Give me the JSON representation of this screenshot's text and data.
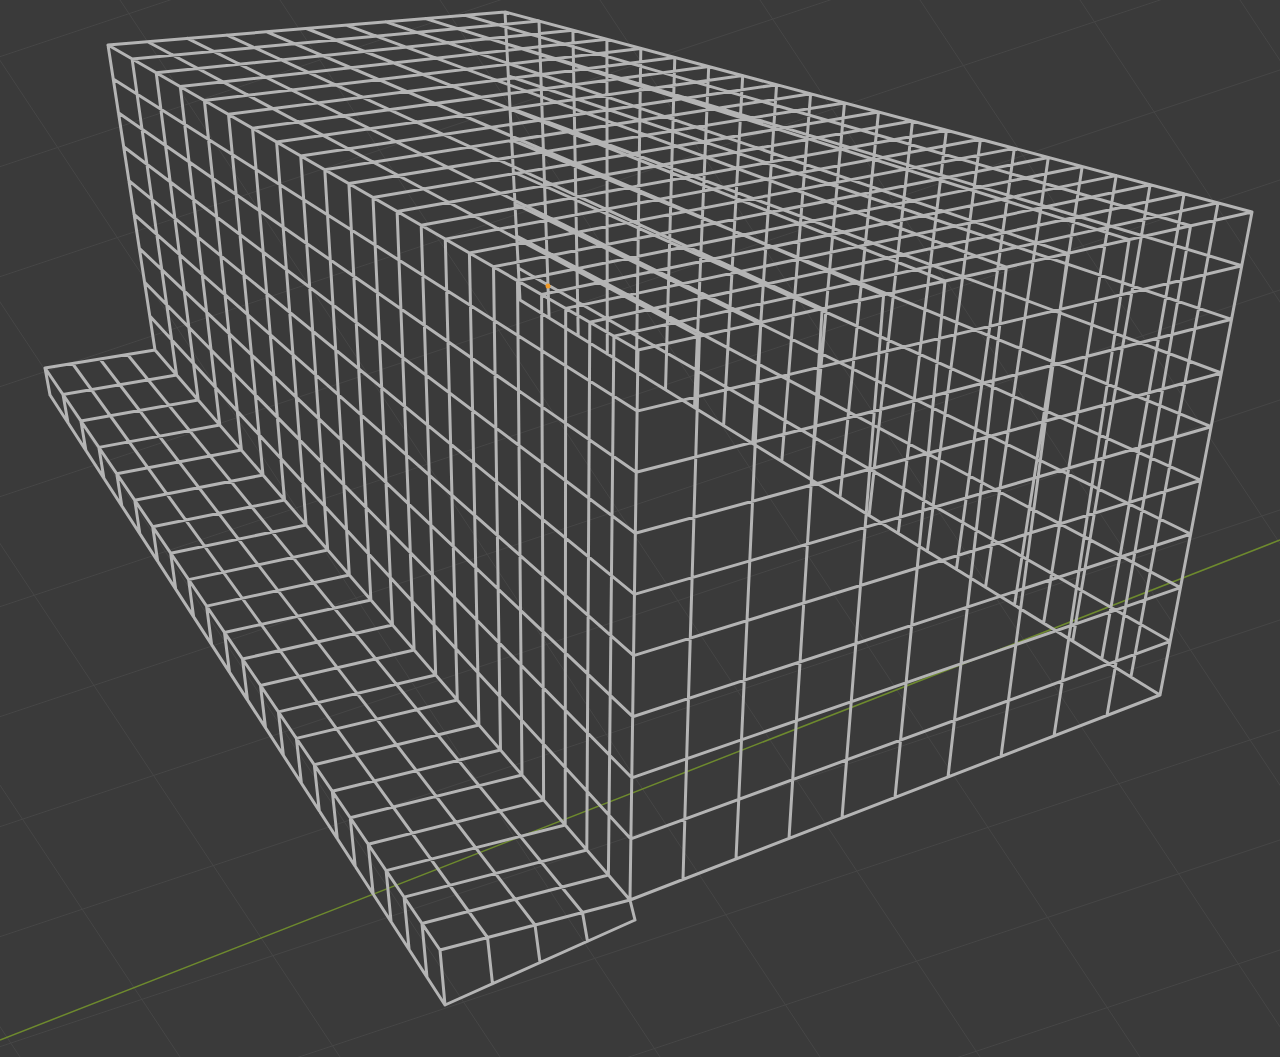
{
  "viewport": {
    "origin_marker": true
  }
}
